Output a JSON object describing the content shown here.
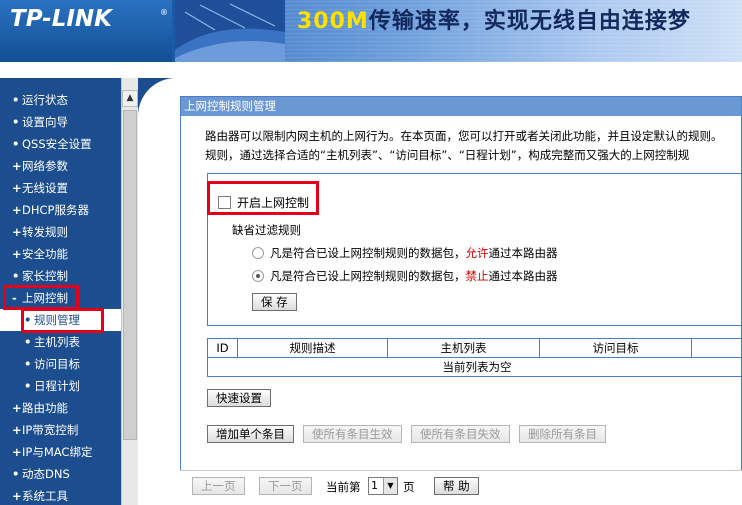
{
  "header": {
    "logo": "TP-LINK",
    "logo_reg": "®",
    "banner_highlight": "300M",
    "banner_text": "传输速率，实现无线自由连接梦"
  },
  "nav": {
    "items": [
      {
        "marker": "•",
        "label": "运行状态"
      },
      {
        "marker": "•",
        "label": "设置向导"
      },
      {
        "marker": "•",
        "label": "QSS安全设置"
      },
      {
        "marker": "+",
        "label": "网络参数"
      },
      {
        "marker": "+",
        "label": "无线设置"
      },
      {
        "marker": "+",
        "label": "DHCP服务器"
      },
      {
        "marker": "+",
        "label": "转发规则"
      },
      {
        "marker": "+",
        "label": "安全功能"
      },
      {
        "marker": "•",
        "label": "家长控制"
      },
      {
        "marker": "-",
        "label": "上网控制"
      },
      {
        "marker": "•",
        "label": "规则管理"
      },
      {
        "marker": "•",
        "label": "主机列表"
      },
      {
        "marker": "•",
        "label": "访问目标"
      },
      {
        "marker": "•",
        "label": "日程计划"
      },
      {
        "marker": "+",
        "label": "路由功能"
      },
      {
        "marker": "+",
        "label": "IP带宽控制"
      },
      {
        "marker": "+",
        "label": "IP与MAC绑定"
      },
      {
        "marker": "•",
        "label": "动态DNS"
      },
      {
        "marker": "+",
        "label": "系统工具"
      }
    ],
    "scroll_up_glyph": "▲"
  },
  "panel": {
    "title": "上网控制规则管理",
    "intro_line1": "路由器可以限制内网主机的上网行为。在本页面，您可以打开或者关闭此功能，并且设定默认的规则。",
    "intro_line2": "规则，通过选择合适的“主机列表”、“访问目标”、“日程计划”，构成完整而又强大的上网控制规"
  },
  "settings": {
    "enable_label": "开启上网控制",
    "enable_checked": false,
    "default_filter_label": "缺省过滤规则",
    "radio1_before": "凡是符合已设上网控制规则的数据包，",
    "radio1_keyword": "允许",
    "radio1_after": "通过本路由器",
    "radio2_before": "凡是符合已设上网控制规则的数据包，",
    "radio2_keyword": "禁止",
    "radio2_after": "通过本路由器",
    "selected_radio": 2,
    "save_label": "保 存"
  },
  "table": {
    "headers": [
      "ID",
      "规则描述",
      "主机列表",
      "访问目标",
      ""
    ],
    "empty_text": "当前列表为空"
  },
  "actions": {
    "quick_setup": "快速设置",
    "add_single": "增加单个条目",
    "enable_all": "使所有条目生效",
    "disable_all": "使所有条目失效",
    "delete_all": "删除所有条目"
  },
  "pager": {
    "prev": "上一页",
    "next": "下一页",
    "current_label": "当前第",
    "current_page": "1",
    "page_unit": "页",
    "help": "帮 助",
    "select_arrow": "▼"
  },
  "colors": {
    "nav_bg": "#1c4d8f",
    "panel_title_bg": "#6b97d4",
    "highlight_red": "#e3001b",
    "keyword_red": "#d40000"
  }
}
